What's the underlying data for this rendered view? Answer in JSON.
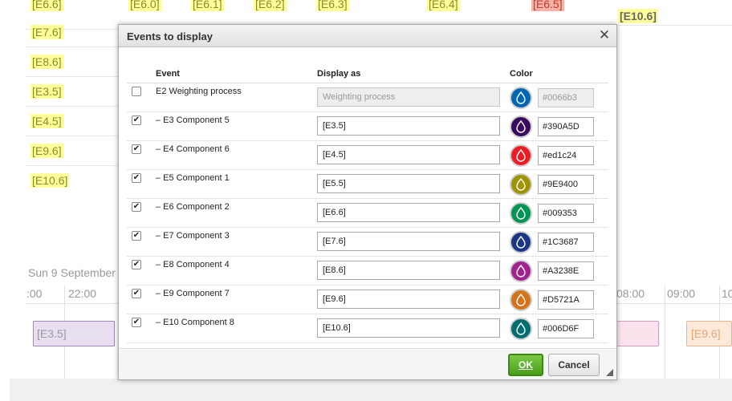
{
  "background": {
    "top_tags": [
      "[E6.6]",
      "[E6.0]",
      "[E6.1]",
      "[E6.2]",
      "[E6.3]",
      "[E6.4]",
      "[E6.5]"
    ],
    "side_tags": [
      "[E7.6]",
      "[E8.6]",
      "[E3.5]",
      "[E4.5]",
      "[E9.6]",
      "[E10.6]"
    ],
    "right_tag": "[E10.6]",
    "date_label": "Sun 9 September",
    "time_labels": [
      ":00",
      "22:00",
      "08:00",
      "09:00",
      "10"
    ],
    "timeline_blocks": [
      "[E3.5]",
      "[E9.6]"
    ]
  },
  "dialog": {
    "title": "Events to display",
    "close_symbol": "✕",
    "columns": {
      "event": "Event",
      "display_as": "Display as",
      "color": "Color"
    },
    "rows": [
      {
        "checked": false,
        "name": "E2 Weighting process",
        "display": "Weighting process",
        "hex": "#0066b3",
        "color": "#0066b3",
        "disabled": true
      },
      {
        "checked": true,
        "name": "– E3 Component 5",
        "display": "[E3.5]",
        "hex": "#390A5D",
        "color": "#390A5D",
        "disabled": false
      },
      {
        "checked": true,
        "name": "– E4 Component 6",
        "display": "[E4.5]",
        "hex": "#ed1c24",
        "color": "#ed1c24",
        "disabled": false
      },
      {
        "checked": true,
        "name": "– E5 Component 1",
        "display": "[E5.5]",
        "hex": "#9E9400",
        "color": "#9E9400",
        "disabled": false
      },
      {
        "checked": true,
        "name": "– E6 Component 2",
        "display": "[E6.6]",
        "hex": "#009353",
        "color": "#009353",
        "disabled": false
      },
      {
        "checked": true,
        "name": "– E7 Component 3",
        "display": "[E7.6]",
        "hex": "#1C3687",
        "color": "#1C3687",
        "disabled": false
      },
      {
        "checked": true,
        "name": "– E8 Component 4",
        "display": "[E8.6]",
        "hex": "#A3238E",
        "color": "#A3238E",
        "disabled": false
      },
      {
        "checked": true,
        "name": "– E9 Component 7",
        "display": "[E9.6]",
        "hex": "#D5721A",
        "color": "#D5721A",
        "disabled": false
      },
      {
        "checked": true,
        "name": "– E10 Component 8",
        "display": "[E10.6]",
        "hex": "#006D6F",
        "color": "#006D6F",
        "disabled": false
      }
    ],
    "ok_label": "OK",
    "cancel_label": "Cancel"
  }
}
